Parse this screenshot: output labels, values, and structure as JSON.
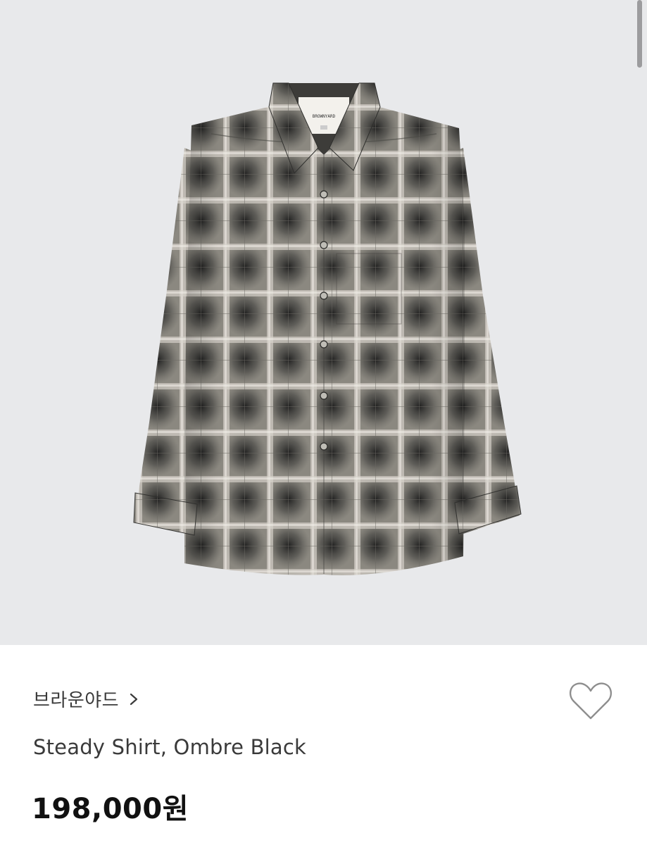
{
  "product": {
    "brand": "브라운야드",
    "name": "Steady Shirt, Ombre Black",
    "price": "198,000원",
    "label_text": "BROWNYARD"
  },
  "icons": {
    "brand_chevron": "chevron-right-icon",
    "wishlist": "heart-outline-icon"
  },
  "colors": {
    "hero_background": "#e8e9eb",
    "text_primary": "#111111",
    "text_secondary": "#3a3a3a",
    "heart_stroke": "#8e8e8e"
  }
}
